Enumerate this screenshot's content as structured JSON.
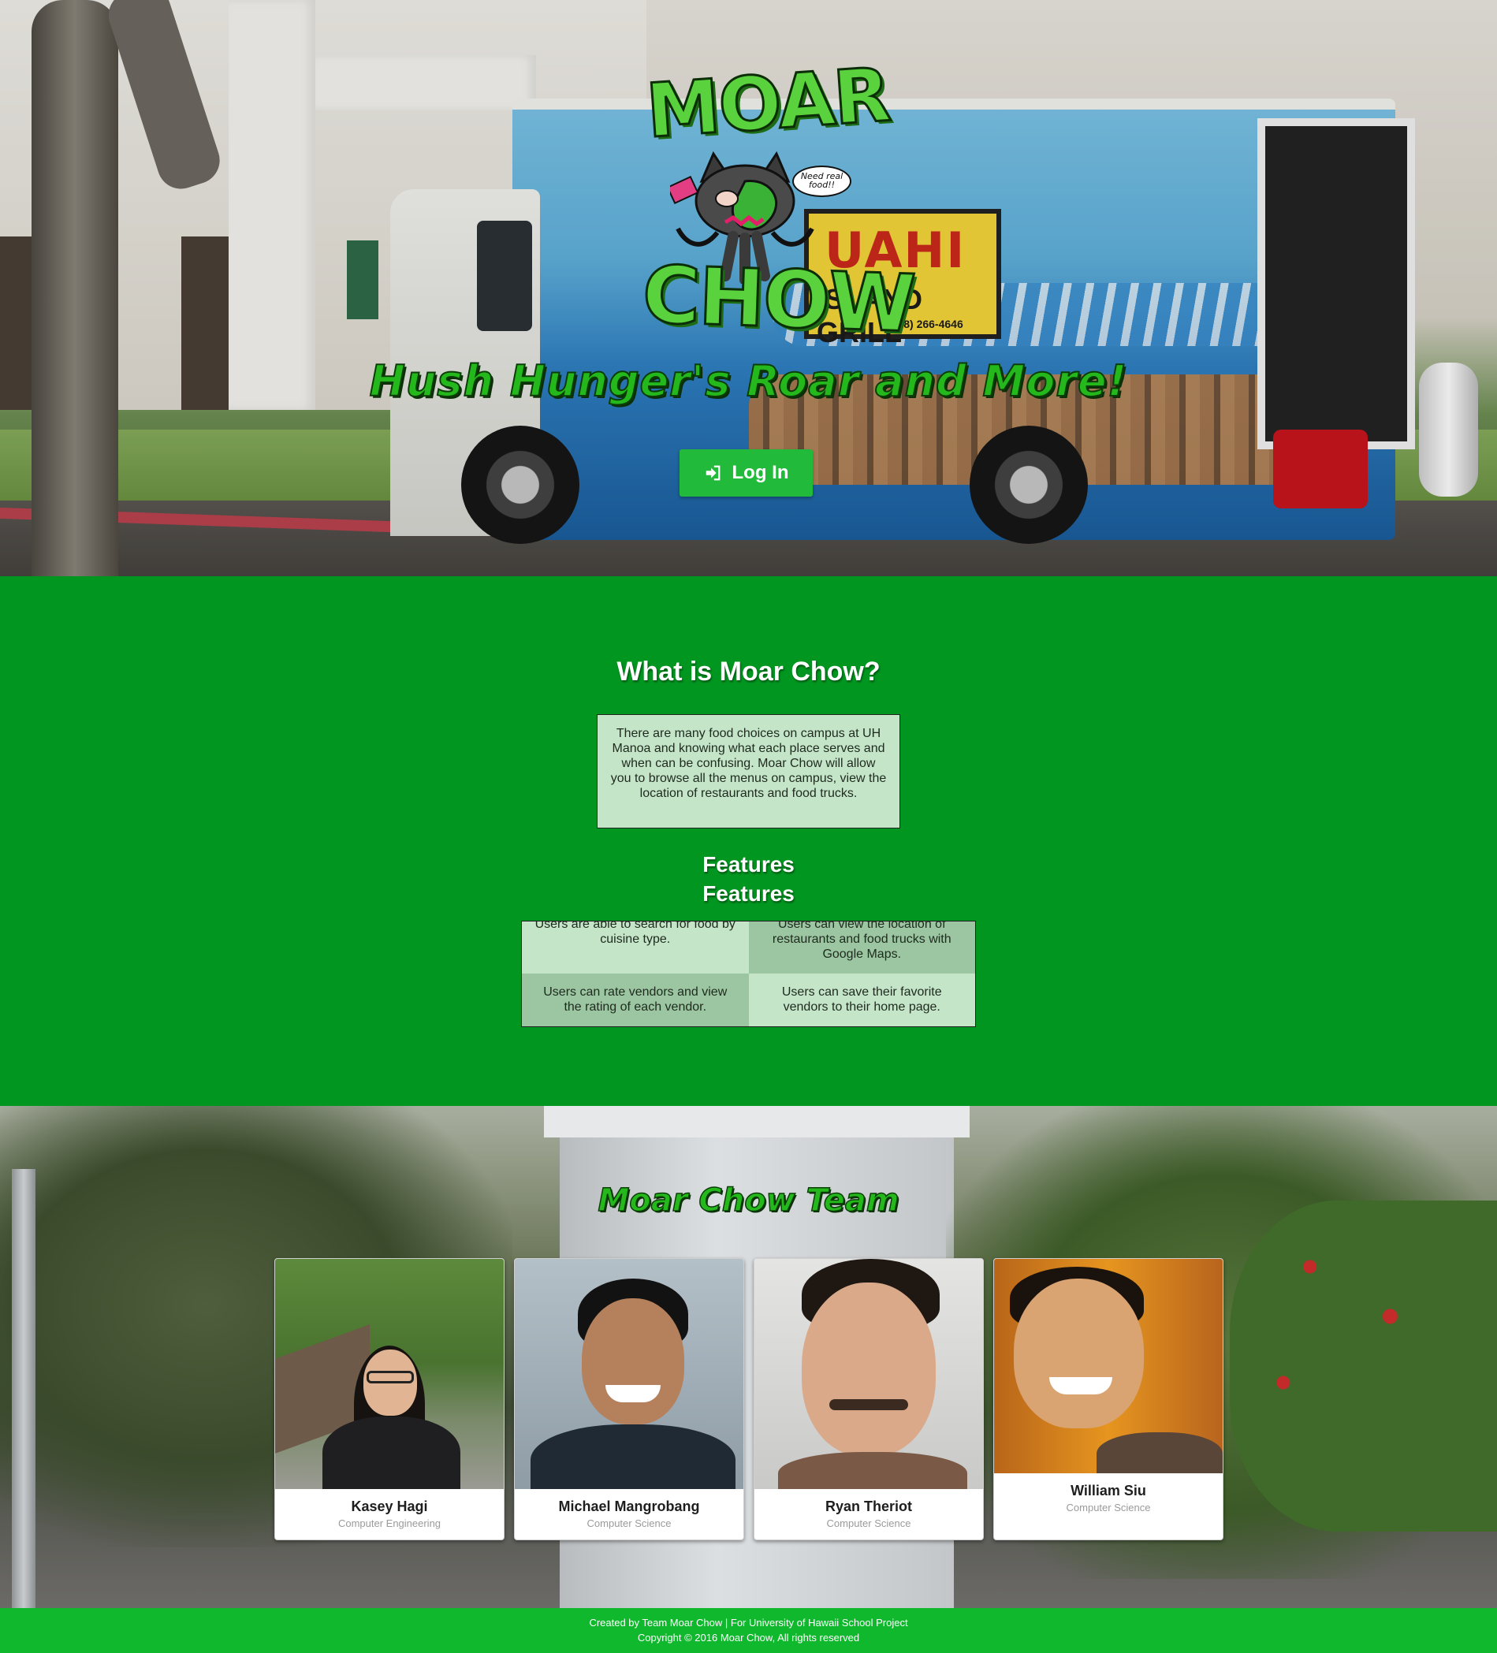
{
  "hero": {
    "logo_text_top": "MOAR",
    "logo_text_bottom": "CHOW",
    "logo_bubble": [
      "Need real",
      "food!!"
    ],
    "truck_sign_title": "UAHI",
    "truck_sign_sub": "ISLAND GRILL",
    "truck_sign_phone": "(808) 266-4646",
    "tagline": "Hush Hunger's Roar and More!",
    "login_label": "Log In",
    "login_icon": "sign-in-icon"
  },
  "about": {
    "heading": "What is Moar Chow?",
    "text": "There are many food choices on campus at UH Manoa and knowing what each place serves and when can be confusing. Moar Chow will allow you to browse all the menus on campus, view the location of restaurants and food trucks."
  },
  "features": {
    "heading_1": "Features",
    "heading_2": "Features",
    "items": [
      "Users are able to search for food by cuisine type.",
      "Users can view the location of restaurants and food trucks with Google Maps.",
      "Users can rate vendors and view the rating of each vendor.",
      "Users can save their favorite vendors to their home page."
    ]
  },
  "team": {
    "heading": "Moar Chow Team",
    "members": [
      {
        "name": "Kasey Hagi",
        "role": "Computer Engineering"
      },
      {
        "name": "Michael Mangrobang",
        "role": "Computer Science"
      },
      {
        "name": "Ryan Theriot",
        "role": "Computer Science"
      },
      {
        "name": "William Siu",
        "role": "Computer Science"
      }
    ]
  },
  "footer": {
    "line1": "Created by Team Moar Chow | For University of Hawaii School Project",
    "line2": "Copyright © 2016 Moar Chow, All rights reserved"
  },
  "colors": {
    "brand_green": "#00961f",
    "button_green": "#21ba3a",
    "footer_green": "#0fb82c",
    "box_light": "#c5e5c9",
    "box_dark": "#9bc6a1"
  }
}
